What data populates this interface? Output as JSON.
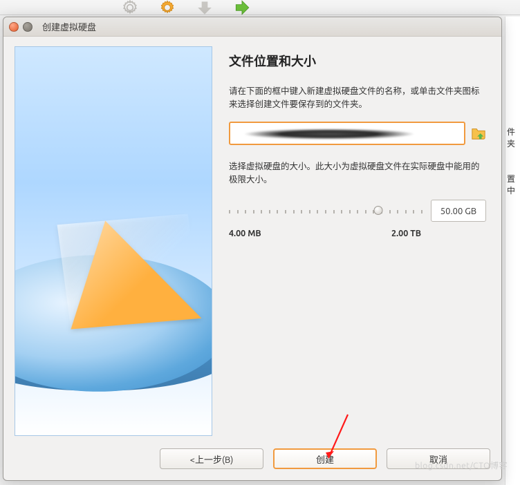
{
  "titlebar": {
    "title": "创建虚拟硬盘"
  },
  "heading": "文件位置和大小",
  "desc1": "请在下面的框中键入新建虚拟硬盘文件的名称，或单击文件夹图标来选择创建文件要保存到的文件夹。",
  "desc2": "选择虚拟硬盘的大小。此大小为虚拟硬盘文件在实际硬盘中能用的极限大小。",
  "path": {
    "value": ""
  },
  "size": {
    "current": "50.00 GB",
    "min": "4.00 MB",
    "max": "2.00 TB"
  },
  "buttons": {
    "back": "<上一步(B)",
    "create": "创建",
    "cancel": "取消"
  },
  "sidelabels": {
    "a": "件夹",
    "b": "置中"
  },
  "watermark": "blog.csdn.net/CTO博客"
}
